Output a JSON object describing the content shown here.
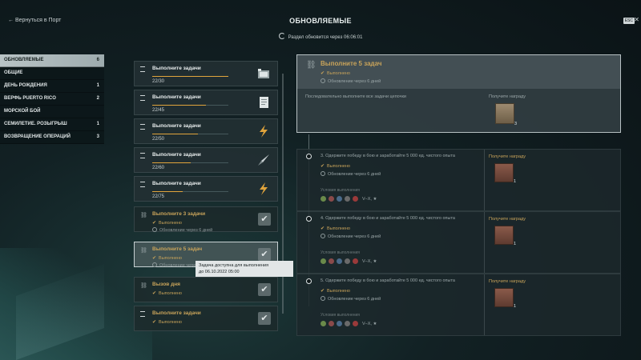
{
  "header": {
    "back": "← Вернуться в Порт",
    "title": "ОБНОВЛЯЕМЫЕ",
    "refresh": "Раздел обновится через 06:06:01",
    "esc": "ESC"
  },
  "sidebar": {
    "items": [
      {
        "label": "ОБНОВЛЯЕМЫЕ",
        "count": "6"
      },
      {
        "label": "ОБЩИЕ",
        "count": ""
      },
      {
        "label": "ДЕНЬ РОЖДЕНИЯ",
        "count": "1"
      },
      {
        "label": "ВЕРФЬ PUERTO RICO",
        "count": "2"
      },
      {
        "label": "МОРСКОЙ БОЙ",
        "count": ""
      },
      {
        "label": "СЕМИЛЕТИЕ. РОЗЫГРЫШ",
        "count": "1"
      },
      {
        "label": "ВОЗВРАЩЕНИЕ ОПЕРАЦИЙ",
        "count": "3"
      }
    ]
  },
  "list": {
    "cards": [
      {
        "title": "Выполните задачи",
        "progress": "22/30",
        "fill": 1.0,
        "icon": "flag-banner-icon"
      },
      {
        "title": "Выполните задачи",
        "progress": "22/45",
        "fill": 0.7,
        "icon": "document-icon"
      },
      {
        "title": "Выполните задачи",
        "progress": "22/50",
        "fill": 0.6,
        "icon": "lightning-icon"
      },
      {
        "title": "Выполните задачи",
        "progress": "22/60",
        "fill": 0.5,
        "icon": "rocket-icon"
      },
      {
        "title": "Выполните задачи",
        "progress": "22/75",
        "fill": 0.4,
        "icon": "lightning-icon"
      },
      {
        "title": "Выполните 3 задачи",
        "status": "Выполнено",
        "status2": "Обновление через 6 дней"
      },
      {
        "title": "Выполните 5 задач",
        "status": "Выполнено",
        "status2": "Обновление через 6 дней"
      },
      {
        "title": "Вызов дня",
        "status": "Выполнено"
      },
      {
        "title": "Выполните задачи",
        "status": "Выполнено"
      }
    ]
  },
  "tooltip": {
    "line1": "Задача доступна для выполнения",
    "line2": "до 06.10.2022 05:00"
  },
  "detail": {
    "title": "Выполните 5 задач",
    "status": "Выполнено",
    "status2": "Обновление через 6 дней",
    "description": "Последовательно выполните все задачи цепочки",
    "reward_label": "Получите награду",
    "reward_count": "3"
  },
  "tasks": [
    {
      "title": "3. Одержите победу в бою и заработайте 5 000 ед. чистого опыта",
      "status": "Выполнено",
      "status2": "Обновление через 6 дней",
      "cond": "Условия выполнения",
      "tier": "V–X, ★",
      "reward_label": "Получите награду",
      "reward_count": "1"
    },
    {
      "title": "4. Одержите победу в бою и заработайте 5 000 ед. чистого опыта",
      "status": "Выполнено",
      "status2": "Обновление через 6 дней",
      "cond": "Условия выполнения",
      "tier": "V–X, ★",
      "reward_label": "Получите награду",
      "reward_count": "1"
    },
    {
      "title": "5. Одержите победу в бою и заработайте 5 000 ед. чистого опыта",
      "status": "Выполнено",
      "status2": "Обновление через 6 дней",
      "cond": "Условия выполнения",
      "tier": "V–X, ★",
      "reward_label": "Получите награду",
      "reward_count": "1"
    }
  ],
  "colors": {
    "accent": "#c8a35a",
    "progress": "#e0a43c"
  }
}
